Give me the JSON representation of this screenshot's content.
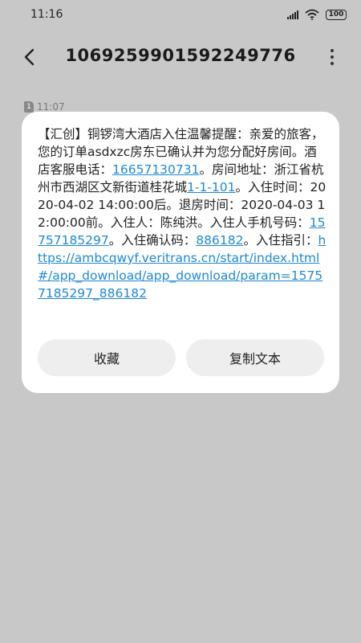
{
  "status_bar": {
    "time": "11:16",
    "battery": "100"
  },
  "header": {
    "title": "1069259901592249776"
  },
  "background_message": {
    "sim": "1",
    "time": "11:07"
  },
  "dialog": {
    "segments": [
      {
        "text": "【汇创】铜锣湾大酒店入住温馨提醒：亲爱的旅客，您的订单asdxzc房东已确认并为您分配好房间。酒店客服电话：",
        "link": false
      },
      {
        "text": "16657130731",
        "link": true
      },
      {
        "text": "。房间地址：浙江省杭州市西湖区文新街道桂花城",
        "link": false
      },
      {
        "text": "1-1-101",
        "link": true
      },
      {
        "text": "。入住时间：2020-04-02 14:00:00后。退房时间：2020-04-03 12:00:00前。入住人：陈纯洪。入住人手机号码：",
        "link": false
      },
      {
        "text": "15757185297",
        "link": true
      },
      {
        "text": "。入住确认码：",
        "link": false
      },
      {
        "text": "886182",
        "link": true
      },
      {
        "text": "。入住指引：",
        "link": false
      },
      {
        "text": "https://ambcqwyf.veritrans.cn/start/index.html#/app_download/app_download/param=15757185297_886182",
        "link": true
      }
    ],
    "buttons": {
      "favorite": "收藏",
      "copy_text": "复制文本"
    }
  },
  "colors": {
    "link": "#1e88d6",
    "background": "#c8c8c8",
    "dialog": "#ffffff",
    "button": "#eeeeee"
  }
}
